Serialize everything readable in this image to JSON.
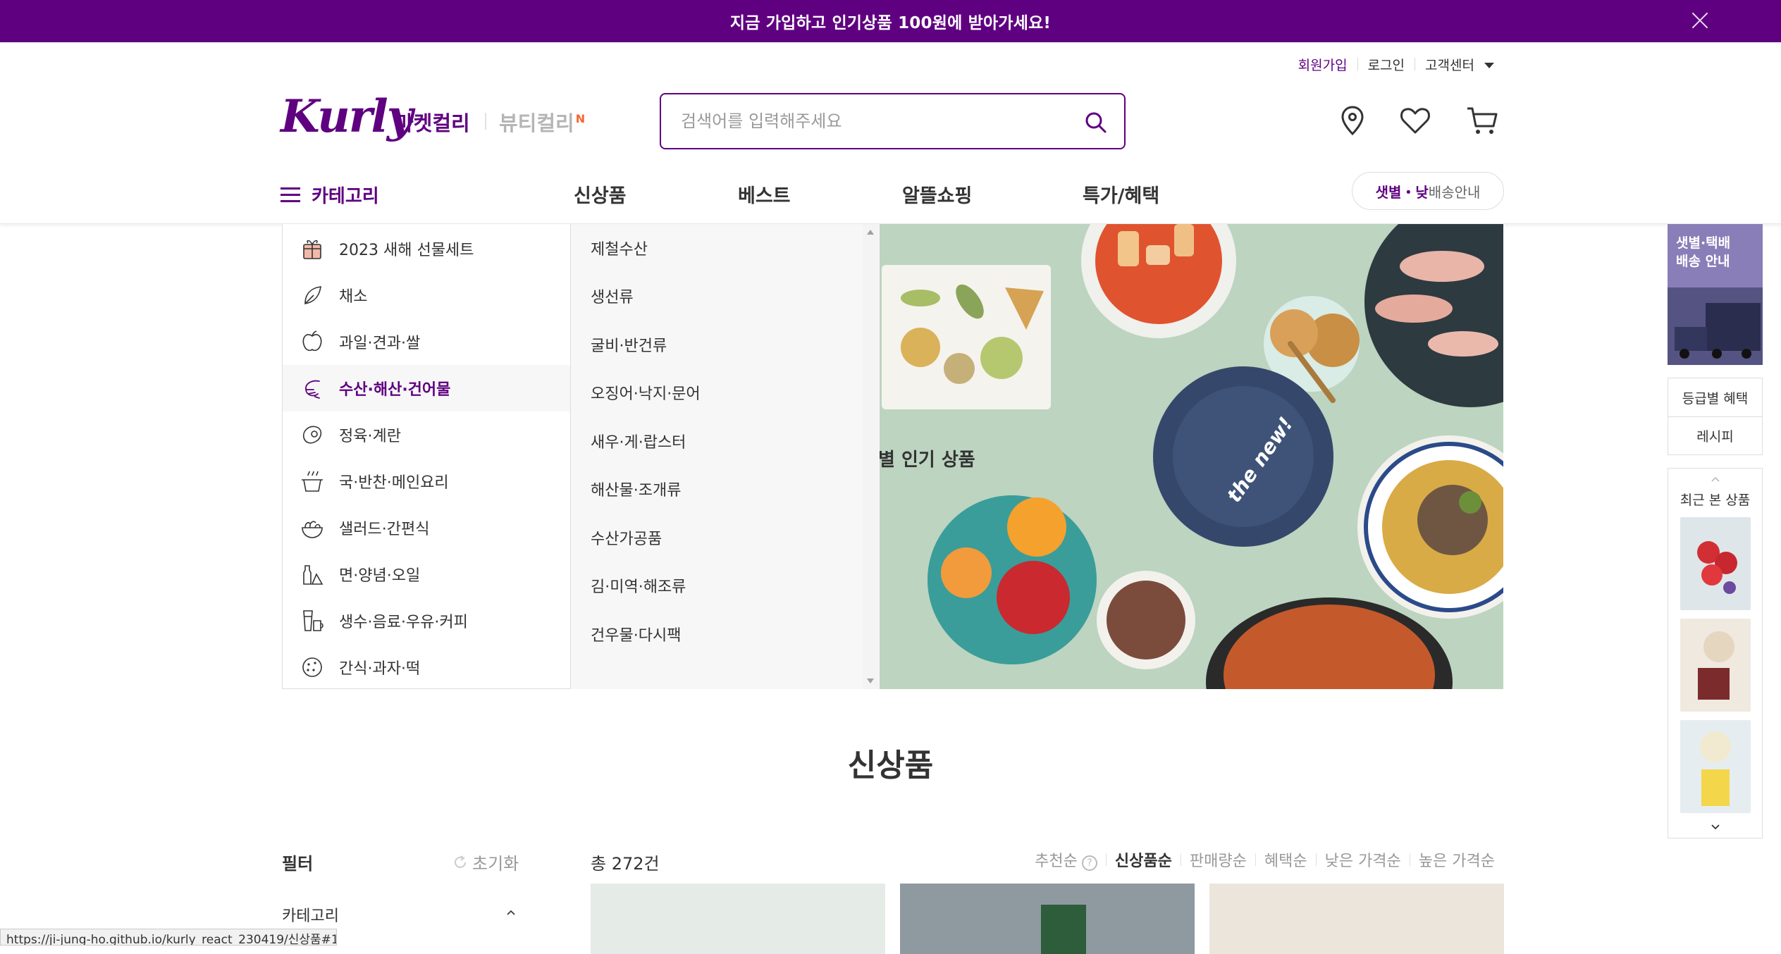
{
  "topbar": {
    "message": "지금 가입하고 인기상품 100원에 받아가세요!"
  },
  "util": {
    "join": "회원가입",
    "login": "로그인",
    "cs": "고객센터"
  },
  "logo": {
    "text": "Kurly"
  },
  "mall": {
    "market": "마켓컬리",
    "beauty": "뷰티컬리",
    "beauty_badge": "N"
  },
  "search": {
    "placeholder": "검색어를 입력해주세요"
  },
  "gnb": {
    "category": "카테고리",
    "menus": [
      "신상품",
      "베스트",
      "알뜰쇼핑",
      "특가/혜택"
    ],
    "delivery_bold": "샛별・낮",
    "delivery_rest": "배송안내"
  },
  "dropdown": {
    "primary": [
      "2023 새해 선물세트",
      "채소",
      "과일·견과·쌀",
      "수산·해산·건어물",
      "정육·계란",
      "국·반찬·메인요리",
      "샐러드·간편식",
      "면·양념·오일",
      "생수·음료·우유·커피",
      "간식·과자·떡"
    ],
    "active_index": 3,
    "secondary": [
      "제철수산",
      "생선류",
      "굴비·반건류",
      "오징어·낙지·문어",
      "새우·게·랍스터",
      "해산물·조개류",
      "수산가공품",
      "김·미역·해조류",
      "건우물·다시팩"
    ]
  },
  "banner": {
    "text": "별 인기 상품",
    "plate_text": "the new!"
  },
  "quick": {
    "promo": "샛별·택배\n배송 안내",
    "benefit": "등급별 혜택",
    "recipe": "레시피",
    "recent_title": "최근 본 상품"
  },
  "section": {
    "title": "신상품"
  },
  "filter": {
    "title": "필터",
    "reset": "초기화",
    "category": "카테고리"
  },
  "list": {
    "count": "총 272건",
    "sort": [
      "추천순",
      "신상품순",
      "판매량순",
      "혜택순",
      "낮은 가격순",
      "높은 가격순"
    ],
    "active_sort": 1
  },
  "status": {
    "url": "https://ji-jung-ho.github.io/kurly_react_230419/신상품#1"
  },
  "colors": {
    "brand": "#5f0080",
    "banner_bg": "#bcd4c0"
  }
}
